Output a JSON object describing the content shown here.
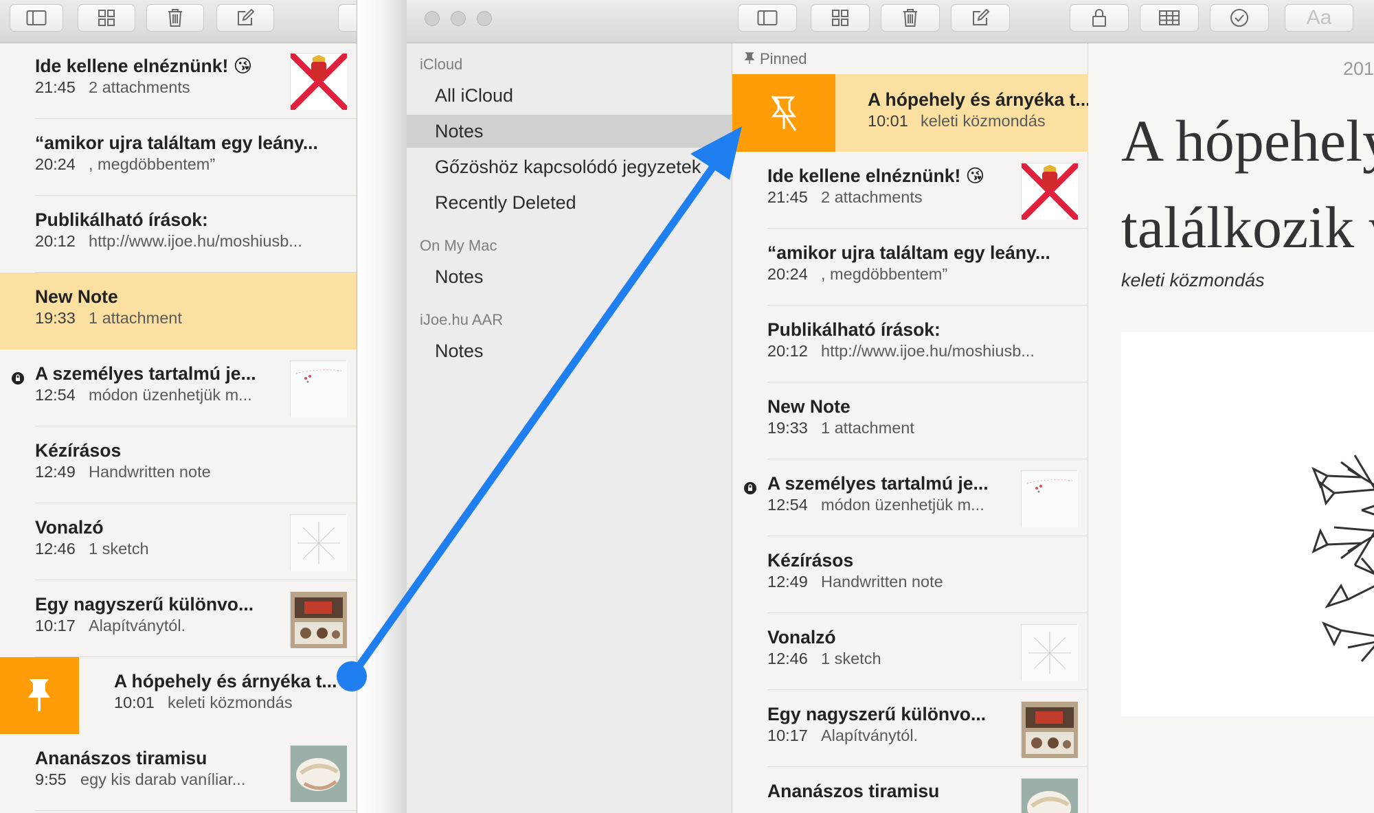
{
  "left_window": {
    "notes": [
      {
        "title": "Ide kellene elnéznünk! 😘",
        "time": "21:45",
        "preview": "2 attachments",
        "thumb": "flag"
      },
      {
        "title": "“amikor ujra találtam egy leány...",
        "time": "20:24",
        "preview": ", megdöbbentem”",
        "thumb": ""
      },
      {
        "title": "Publikálható írások:",
        "time": "20:12",
        "preview": "http://www.ijoe.hu/moshiusb...",
        "thumb": ""
      },
      {
        "title": "New Note",
        "time": "19:33",
        "preview": "1 attachment",
        "thumb": "",
        "selected": true
      },
      {
        "title": "A személyes tartalmú je...",
        "time": "12:54",
        "preview": "módon üzenhetjük m...",
        "thumb": "sketch-dots",
        "locked": true
      },
      {
        "title": "Kézírásos",
        "time": "12:49",
        "preview": "Handwritten note",
        "thumb": ""
      },
      {
        "title": "Vonalzó",
        "time": "12:46",
        "preview": "1 sketch",
        "thumb": "sketch-lines"
      },
      {
        "title": "Egy nagyszerű különvo...",
        "time": "10:17",
        "preview": "Alapítványtól.",
        "thumb": "photo"
      },
      {
        "title": "A hópehely és árnyéka t...",
        "time": "10:01",
        "preview": "keleti közmondás",
        "thumb": "",
        "swiped": true
      },
      {
        "title": "Ananászos tiramisu",
        "time": "9:55",
        "preview": "egy kis darab vaníliar...",
        "thumb": "food"
      }
    ]
  },
  "right_window": {
    "folders": {
      "icloud_header": "iCloud",
      "icloud_items": [
        "All iCloud",
        "Notes",
        "Gőzöshöz kapcsolódó jegyzetek",
        "Recently Deleted"
      ],
      "selected": "Notes",
      "mac_header": "On My Mac",
      "mac_items": [
        "Notes"
      ],
      "ijoe_header": "iJoe.hu AAR",
      "ijoe_items": [
        "Notes"
      ]
    },
    "pinned_label": "Pinned",
    "pinned_note": {
      "title": "A hópehely és árnyéka t...",
      "time": "10:01",
      "preview": "keleti közmondás"
    },
    "notes": [
      {
        "title": "Ide kellene elnéznünk! 😘",
        "time": "21:45",
        "preview": "2 attachments",
        "thumb": "flag"
      },
      {
        "title": "“amikor ujra találtam egy leány...",
        "time": "20:24",
        "preview": ", megdöbbentem”",
        "thumb": ""
      },
      {
        "title": "Publikálható írások:",
        "time": "20:12",
        "preview": "http://www.ijoe.hu/moshiusb...",
        "thumb": ""
      },
      {
        "title": "New Note",
        "time": "19:33",
        "preview": "1 attachment",
        "thumb": ""
      },
      {
        "title": "A személyes tartalmú je...",
        "time": "12:54",
        "preview": "módon üzenhetjük m...",
        "thumb": "sketch-dots",
        "locked": true
      },
      {
        "title": "Kézírásos",
        "time": "12:49",
        "preview": "Handwritten note",
        "thumb": ""
      },
      {
        "title": "Vonalzó",
        "time": "12:46",
        "preview": "1 sketch",
        "thumb": "sketch-lines"
      },
      {
        "title": "Egy nagyszerű különvo...",
        "time": "10:17",
        "preview": "Alapítványtól.",
        "thumb": "photo"
      },
      {
        "title": "Ananászos tiramisu",
        "time": "",
        "preview": "",
        "thumb": "food"
      }
    ],
    "editor": {
      "date": "201",
      "title_line1": "A hópehely",
      "title_line2": "találkozik v",
      "subtitle": "keleti közmondás"
    },
    "toolbar_icons": [
      "sidebar-icon",
      "grid-icon",
      "trash-icon",
      "compose-icon",
      "lock-icon",
      "table-icon",
      "checklist-icon",
      "format-icon"
    ],
    "format_label": "Aa"
  },
  "colors": {
    "accent_orange": "#fe9d07",
    "selection_yellow": "#fbe0a1",
    "arrow_blue": "#1f7ff0"
  }
}
